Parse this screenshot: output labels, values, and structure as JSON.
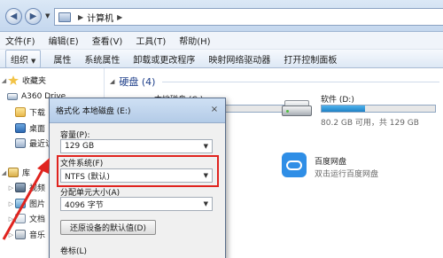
{
  "address": {
    "path_item": "计算机"
  },
  "menu": [
    {
      "label": "文件(F)"
    },
    {
      "label": "编辑(E)"
    },
    {
      "label": "查看(V)"
    },
    {
      "label": "工具(T)"
    },
    {
      "label": "帮助(H)"
    }
  ],
  "toolbar": {
    "organize": "组织",
    "items": [
      {
        "label": "属性"
      },
      {
        "label": "系统属性"
      },
      {
        "label": "卸载或更改程序"
      },
      {
        "label": "映射网络驱动器"
      },
      {
        "label": "打开控制面板"
      }
    ]
  },
  "nav": {
    "favorites": "收藏夹",
    "a360": "A360 Drive",
    "downloads": "下载",
    "desktop": "桌面",
    "recent": "最近访",
    "library": "库",
    "video": "视频",
    "pictures": "图片",
    "documents": "文档",
    "music": "音乐"
  },
  "content": {
    "group_title": "硬盘 (4)",
    "local_disk": {
      "name": "本地磁盘 (C:)"
    },
    "soft_disk": {
      "name": "软件 (D:)",
      "size": "80.2 GB 可用，共 129 GB",
      "used_fraction": 0.38
    },
    "baidu": {
      "name": "百度网盘",
      "desc": "双击运行百度网盘"
    }
  },
  "dialog": {
    "title": "格式化 本地磁盘 (E:)",
    "close": "×",
    "capacity_label": "容量(P):",
    "capacity_value": "129 GB",
    "fs_label": "文件系统(F)",
    "fs_value": "NTFS (默认)",
    "alloc_label": "分配单元大小(A)",
    "alloc_value": "4096 字节",
    "restore_button": "还原设备的默认值(D)",
    "volume_label": "卷标(L)"
  },
  "colors": {
    "highlight": "#e0241f",
    "progress": "#1f81c6",
    "group_title": "#1e3f8a"
  }
}
